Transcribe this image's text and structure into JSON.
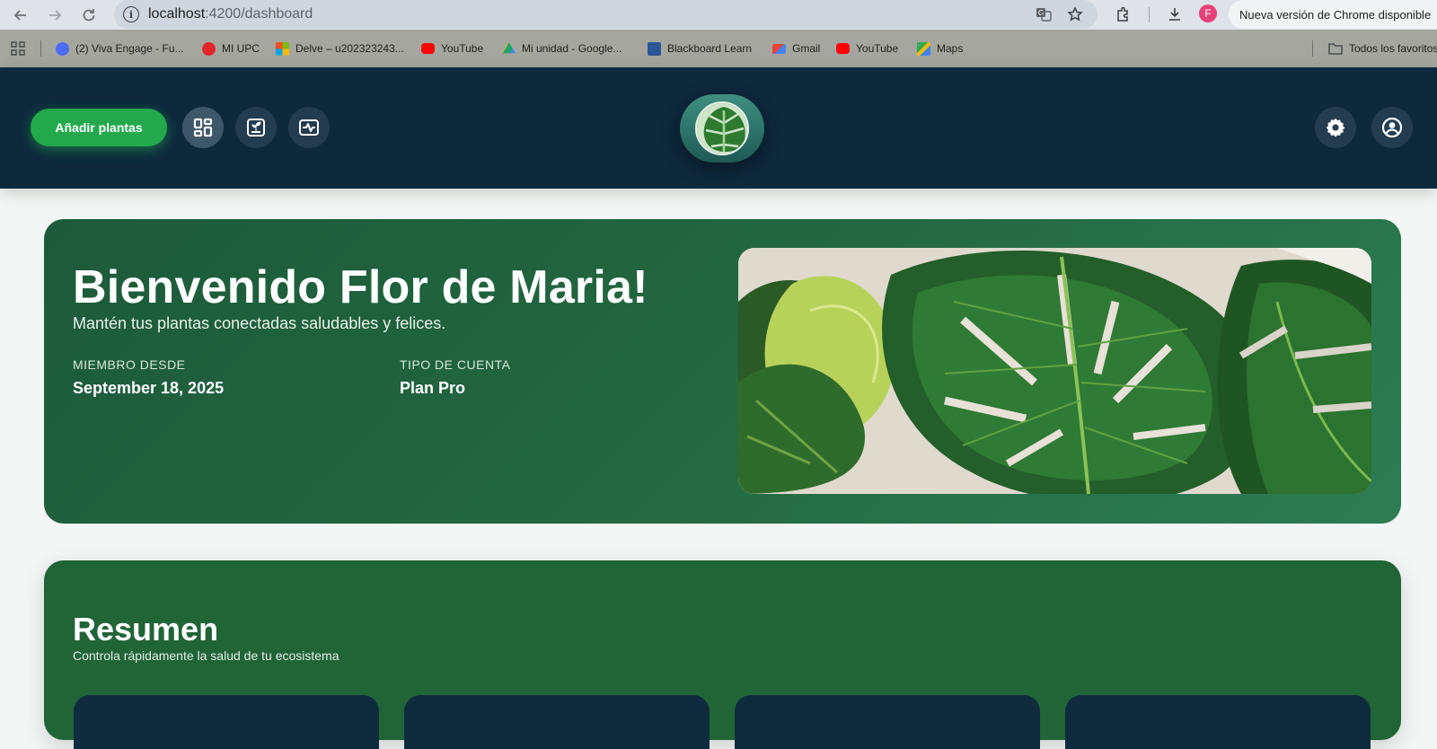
{
  "browser": {
    "url_host": "localhost",
    "url_path": ":4200/dashboard",
    "profile_initial": "F",
    "update_label": "Nueva versión de Chrome disponible",
    "bookmarks": [
      {
        "label": "(2) Viva Engage - Fu...",
        "icon": "viva-engage-icon",
        "color": "#4a6cf7"
      },
      {
        "label": "MI UPC",
        "icon": "upc-icon",
        "color": "#e3262b"
      },
      {
        "label": "Delve – u202323243...",
        "icon": "microsoft-icon",
        "color": "#f25022"
      },
      {
        "label": "YouTube",
        "icon": "youtube-icon",
        "color": "#ff0000"
      },
      {
        "label": "Mi unidad - Google...",
        "icon": "google-drive-icon",
        "color": "#1fa463"
      },
      {
        "label": "Blackboard Learn",
        "icon": "blackboard-icon",
        "color": "#2b5797"
      },
      {
        "label": "Gmail",
        "icon": "gmail-icon",
        "color": "#ea4335"
      },
      {
        "label": "YouTube",
        "icon": "youtube-icon",
        "color": "#ff0000"
      },
      {
        "label": "Maps",
        "icon": "maps-icon",
        "color": "#34a853"
      }
    ],
    "all_bookmarks_label": "Todos los favoritos"
  },
  "header": {
    "add_plants_label": "Añadir plantas",
    "nav_icons": [
      "dashboard-icon",
      "plant-box-icon",
      "activity-icon"
    ],
    "right_icons": [
      "settings-icon",
      "account-icon"
    ],
    "brand_color": "#0e293c",
    "accent_color": "#23a94c"
  },
  "welcome": {
    "title": "Bienvenido Flor de Maria!",
    "subtitle": "Mantén tus plantas conectadas saludables y felices.",
    "member_since_label": "MIEMBRO DESDE",
    "member_since_value": "September 18, 2025",
    "account_type_label": "TIPO DE CUENTA",
    "account_type_value": "Plan Pro"
  },
  "summary": {
    "title": "Resumen",
    "subtitle": "Controla rápidamente la salud de tu ecosistema"
  }
}
